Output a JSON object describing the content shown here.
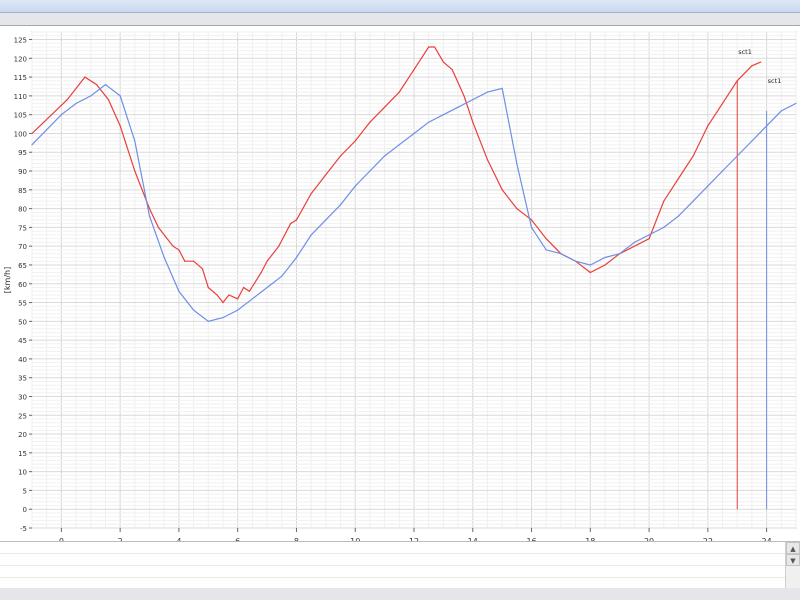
{
  "chart_data": {
    "type": "line",
    "ylabel": "[km/h]",
    "xlim": [
      -1,
      25
    ],
    "ylim": [
      -5,
      127
    ],
    "x_ticks": [
      "0",
      "2",
      "4",
      "6",
      "8",
      "10",
      "12",
      "14",
      "16",
      "18",
      "20",
      "22",
      "24"
    ],
    "x_tick_values": [
      0,
      2,
      4,
      6,
      8,
      10,
      12,
      14,
      16,
      18,
      20,
      22,
      24
    ],
    "y_ticks": [
      "-5",
      "0",
      "5",
      "10",
      "15",
      "20",
      "25",
      "30",
      "35",
      "40",
      "45",
      "50",
      "55",
      "60",
      "65",
      "70",
      "75",
      "80",
      "85",
      "90",
      "95",
      "100",
      "105",
      "110",
      "115",
      "120",
      "125"
    ],
    "y_tick_values": [
      -5,
      0,
      5,
      10,
      15,
      20,
      25,
      30,
      35,
      40,
      45,
      50,
      55,
      60,
      65,
      70,
      75,
      80,
      85,
      90,
      95,
      100,
      105,
      110,
      115,
      120,
      125
    ],
    "grid": true,
    "series": [
      {
        "name": "sct1",
        "color": "#e8403c",
        "x": [
          -1,
          -0.6,
          -0.2,
          0.2,
          0.6,
          0.8,
          1.2,
          1.6,
          2,
          2.5,
          3,
          3.3,
          3.8,
          4,
          4.2,
          4.5,
          4.8,
          5,
          5.3,
          5.5,
          5.7,
          6,
          6.2,
          6.4,
          6.8,
          7,
          7.4,
          7.8,
          8,
          8.5,
          9,
          9.5,
          10,
          10.5,
          11,
          11.5,
          12,
          12.5,
          12.7,
          13,
          13.3,
          13.7,
          14,
          14.5,
          15,
          15.5,
          16,
          16.5,
          17,
          17.5,
          18,
          18.5,
          19,
          19.5,
          20,
          20.5,
          21,
          21.5,
          22,
          22.5,
          23,
          23.5,
          23.8
        ],
        "y": [
          100,
          103,
          106,
          109,
          113,
          115,
          113,
          109,
          102,
          90,
          80,
          75,
          70,
          69,
          66,
          66,
          64,
          59,
          57,
          55,
          57,
          56,
          59,
          58,
          63,
          66,
          70,
          76,
          77,
          84,
          89,
          94,
          98,
          103,
          107,
          111,
          117,
          123,
          123,
          119,
          117,
          110,
          103,
          93,
          85,
          80,
          77,
          72,
          68,
          66,
          63,
          65,
          68,
          70,
          72,
          82,
          88,
          94,
          102,
          108,
          114,
          118,
          119
        ],
        "marker_x": 23,
        "marker_from": 0,
        "marker_to": 114
      },
      {
        "name": "sct1",
        "color": "#6f8fe6",
        "x": [
          -1,
          -0.5,
          0,
          0.5,
          1,
          1.5,
          2,
          2.5,
          3,
          3.5,
          4,
          4.5,
          5,
          5.5,
          6,
          6.5,
          7,
          7.5,
          8,
          8.5,
          9,
          9.5,
          10,
          10.5,
          11,
          11.5,
          12,
          12.5,
          13,
          13.5,
          14,
          14.5,
          15,
          15.5,
          16,
          16.5,
          17,
          17.5,
          18,
          18.5,
          19,
          19.5,
          20,
          20.5,
          21,
          21.5,
          22,
          22.5,
          23,
          23.5,
          24,
          24.5,
          25
        ],
        "y": [
          97,
          101,
          105,
          108,
          110,
          113,
          110,
          98,
          78,
          67,
          58,
          53,
          50,
          51,
          53,
          56,
          59,
          62,
          67,
          73,
          77,
          81,
          86,
          90,
          94,
          97,
          100,
          103,
          105,
          107,
          109,
          111,
          112,
          92,
          75,
          69,
          68,
          66,
          65,
          67,
          68,
          71,
          73,
          75,
          78,
          82,
          86,
          90,
          94,
          98,
          102,
          106,
          108
        ],
        "marker_x": 24,
        "marker_from": 0,
        "marker_to": 106
      }
    ]
  },
  "bottom_panel": {
    "scroll_up": "▲",
    "scroll_down": "▼"
  }
}
